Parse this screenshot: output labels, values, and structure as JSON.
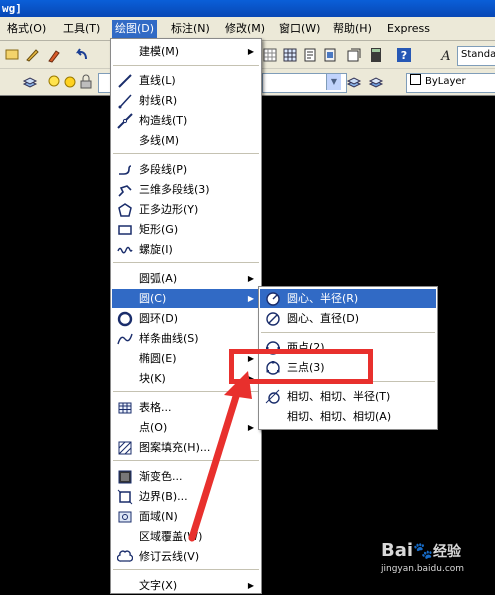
{
  "title_fragment": "wg]",
  "menubar": {
    "items": [
      {
        "label": "格式(O)"
      },
      {
        "label": "工具(T)"
      },
      {
        "label": "绘图(D)"
      },
      {
        "label": "标注(N)"
      },
      {
        "label": "修改(M)"
      },
      {
        "label": "窗口(W)"
      },
      {
        "label": "帮助(H)"
      },
      {
        "label": "Express"
      }
    ]
  },
  "toolbar": {
    "text_style": "Standa",
    "layer_value": "ByLayer"
  },
  "draw_menu": {
    "items": [
      {
        "label": "建模(M)",
        "submenu": true
      },
      {
        "label": "直线(L)"
      },
      {
        "label": "射线(R)"
      },
      {
        "label": "构造线(T)"
      },
      {
        "label": "多线(M)"
      },
      {
        "label": "多段线(P)"
      },
      {
        "label": "三维多段线(3)"
      },
      {
        "label": "正多边形(Y)"
      },
      {
        "label": "矩形(G)"
      },
      {
        "label": "螺旋(I)"
      },
      {
        "label": "圆弧(A)",
        "submenu": true
      },
      {
        "label": "圆(C)",
        "submenu": true
      },
      {
        "label": "圆环(D)"
      },
      {
        "label": "样条曲线(S)"
      },
      {
        "label": "椭圆(E)",
        "submenu": true
      },
      {
        "label": "块(K)",
        "submenu": true
      },
      {
        "label": "表格..."
      },
      {
        "label": "点(O)",
        "submenu": true
      },
      {
        "label": "图案填充(H)..."
      },
      {
        "label": "渐变色..."
      },
      {
        "label": "边界(B)..."
      },
      {
        "label": "面域(N)"
      },
      {
        "label": "区域覆盖(W)"
      },
      {
        "label": "修订云线(V)"
      },
      {
        "label": "文字(X)",
        "submenu": true
      }
    ]
  },
  "circle_submenu": {
    "items": [
      {
        "label": "圆心、半径(R)"
      },
      {
        "label": "圆心、直径(D)"
      },
      {
        "label": "两点(2)"
      },
      {
        "label": "三点(3)"
      },
      {
        "label": "相切、相切、半径(T)"
      },
      {
        "label": "相切、相切、相切(A)"
      }
    ]
  },
  "watermark": {
    "brand": "Bai",
    "brand_suffix": "经验",
    "url": "jingyan.baidu.com"
  },
  "colors": {
    "highlight": "#316ac5",
    "annotation_red": "#e8302d",
    "menu_bg": "#ece9d8"
  }
}
